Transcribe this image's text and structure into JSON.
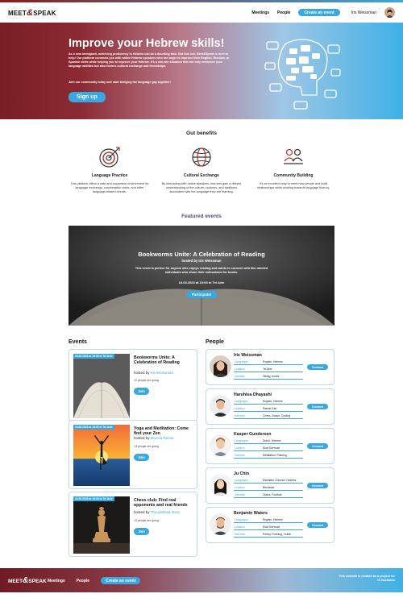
{
  "header": {
    "logo_left": "MEET",
    "logo_amp": "&",
    "logo_right": "SPEAK",
    "nav_meetings": "Meetings",
    "nav_people": "People",
    "create_event": "Create an event",
    "user_name": "Iris Weissman"
  },
  "hero": {
    "title": "Improve your Hebrew skills!",
    "paragraph1": "As a new immigrant, achieving proficiency in Hebrew can be a daunting task. But fear not, Meet&Speak is here to help! Our platform connects you with native Hebrew speakers who are eager to improve their English, Russian, or Spanish skills while helping you to improve your Hebrew. It's a win-win situation that not only enhances your language abilities but also fosters cultural exchange and friendships.",
    "paragraph2": "Join our community today and start bridging the language gap together!",
    "signup": "Sign up"
  },
  "benefits": {
    "title": "Out benefits",
    "items": [
      {
        "icon": "target-icon",
        "title": "Language Practice",
        "desc": "This platform offers a safe and supportive environment for language exchange, conversation clubs, and other language-related events."
      },
      {
        "icon": "globe-icon",
        "title": "Cultural Exchange",
        "desc": "By interacting with native speakers, learners gain a deeper understanding of the culture, customs, and traditions associated with the language they are learning."
      },
      {
        "icon": "community-icon",
        "title": "Community Building",
        "desc": "It's an excellent way to meet new people and build relationships while working towards language fluency."
      }
    ]
  },
  "featured": {
    "section_title": "Featured events",
    "title": "Bookworms Unite: A Celebration of Reading",
    "hosted_prefix": "hosted by",
    "host": "Iris Weissman",
    "description": "This event is perfect for anyone who enjoys reading and wants to connect with like-minded individuals who share their enthusiasm for books.",
    "datetime": "24.03.2023 at 19:00 in Tel Aviv",
    "cta": "Participate!"
  },
  "events": {
    "title": "Events",
    "items": [
      {
        "date": "24.03.2023 at 19:00 in Tel Aviv",
        "title": "Bookworms Unite: A Celebration of Reading",
        "hosted_prefix": "hosted by",
        "host": "Iris Weissman",
        "going": "12 people are going",
        "join": "Join"
      },
      {
        "date": "24.03.2023 at 10:00 in Tel Aviv",
        "title": "Yoga and Meditation: Come find your Zen",
        "hosted_prefix": "hosted by",
        "host": "Monica Reeve",
        "going": "13 people are going",
        "join": "Join"
      },
      {
        "date": "24.03.2023 at 10:00 in Tel Aviv",
        "title": "Chess club: Find real opponents and real friends",
        "hosted_prefix": "hosted by",
        "host": "Theodelinda Dora",
        "going": "12 people are going",
        "join": "Join"
      }
    ]
  },
  "people": {
    "title": "People",
    "labels": {
      "languages": "Languages",
      "location": "Location",
      "interests": "Interests"
    },
    "connect": "Connect",
    "items": [
      {
        "name": "Iris Weissman",
        "languages": "English, Hebrew",
        "location": "Tel Aviv",
        "interests": "Hiking, books"
      },
      {
        "name": "Haruhisa Ohayashi",
        "languages": "English, Hebrew",
        "location": "Ramat Gan",
        "interests": "Chess, Books, Cycling"
      },
      {
        "name": "Kasper Gundersen",
        "languages": "Dutch, Hebrew",
        "location": "Ekat Shemuel",
        "interests": "Meditation, Painting"
      },
      {
        "name": "Ju Chin",
        "languages": "Mandarin Chinese, Hebrew",
        "location": "Beshevat",
        "interests": "Opera, Football"
      },
      {
        "name": "Benjamin Waters",
        "languages": "English, Hebrew",
        "location": "Ekat Shemuel",
        "interests": "Poetry, Running, Guitar"
      }
    ]
  },
  "footer": {
    "logo_left": "MEET",
    "logo_amp": "&",
    "logo_right": "SPEAK",
    "nav_meetings": "Meetings",
    "nav_people": "People",
    "create_event": "Create an event",
    "note": "This website is created as a project for IS Hackaton"
  },
  "colors": {
    "accent": "#3aa8e0",
    "brand_dark": "#7a1d24"
  }
}
